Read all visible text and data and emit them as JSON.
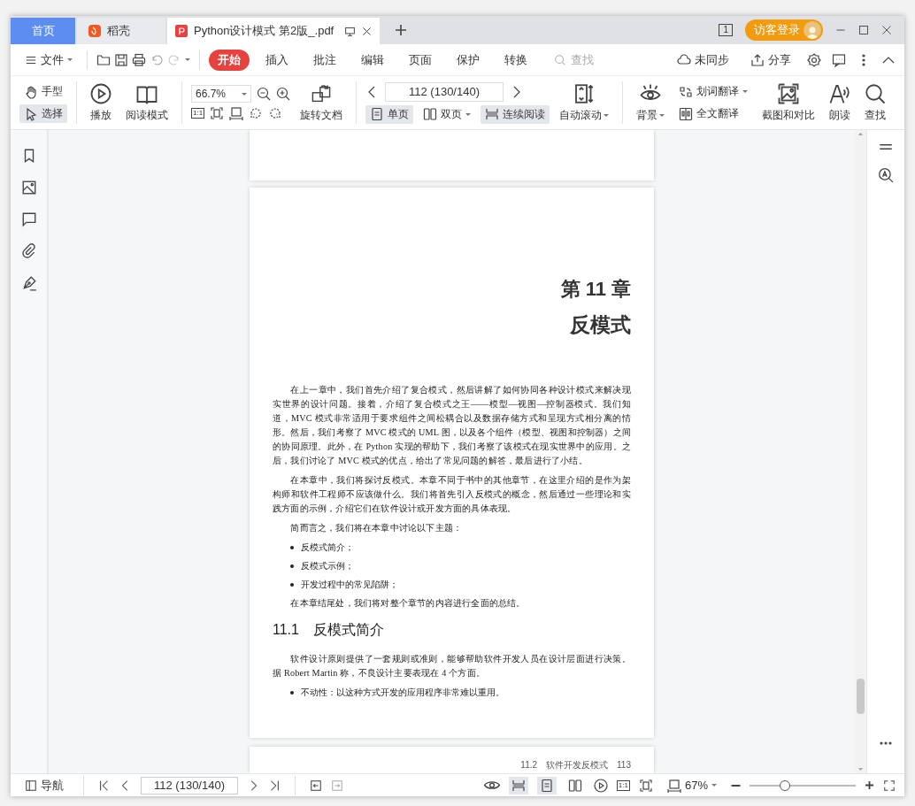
{
  "tabs": [
    {
      "label": "首页",
      "kind": "home",
      "selected": false
    },
    {
      "label": "稻壳",
      "kind": "app",
      "selected": false
    },
    {
      "label": "Python设计模式 第2版_.pdf",
      "kind": "doc",
      "selected": true
    }
  ],
  "title_bar": {
    "window_count": "1",
    "account": "访客登录"
  },
  "menu": {
    "file": "文件",
    "tabs": [
      {
        "label": "开始",
        "selected": true
      },
      {
        "label": "插入",
        "selected": false
      },
      {
        "label": "批注",
        "selected": false
      },
      {
        "label": "编辑",
        "selected": false
      },
      {
        "label": "页面",
        "selected": false
      },
      {
        "label": "保护",
        "selected": false
      },
      {
        "label": "转换",
        "selected": false
      }
    ],
    "search": {
      "placeholder": "查找"
    },
    "sync": "未同步",
    "share": "分享"
  },
  "toolbar": {
    "cursor_tools": [
      {
        "label": "手型",
        "kind": "hand",
        "selected": false
      },
      {
        "label": "选择",
        "kind": "pointer",
        "selected": true
      }
    ],
    "view_buttons": [
      {
        "label": "播放",
        "kind": "play"
      },
      {
        "label": "阅读模式",
        "kind": "book"
      }
    ],
    "zoom": {
      "value": "66.7%"
    },
    "actual_size": "1:1",
    "rotate": "旋转文档",
    "page_field": {
      "value": "112 (130/140)"
    },
    "page_modes": [
      {
        "label": "单页",
        "kind": "single",
        "selected": true,
        "dropdown": false
      },
      {
        "label": "双页",
        "kind": "double",
        "selected": false,
        "dropdown": true
      },
      {
        "label": "连续阅读",
        "kind": "continuous",
        "selected": true,
        "dropdown": false
      }
    ],
    "auto_scroll": "自动滚动",
    "background": "背景",
    "translate": [
      {
        "label": "划词翻译",
        "kind": "word",
        "dropdown": true
      },
      {
        "label": "全文翻译",
        "kind": "full",
        "dropdown": false
      }
    ],
    "tools": [
      {
        "label": "截图和对比",
        "kind": "screenshot"
      },
      {
        "label": "朗读",
        "kind": "read-aloud"
      },
      {
        "label": "查找",
        "kind": "search"
      }
    ]
  },
  "document": {
    "chapter_number": "第 11 章",
    "chapter_title": "反模式",
    "blocks": [
      {
        "kind": "paragraph",
        "text": "在上一章中，我们首先介绍了复合模式，然后讲解了如何协同各种设计模式来解决现实世界的设计问题。接着，介绍了复合模式之王——模型—视图—控制器模式。我们知道，MVC 模式非常适用于要求组件之间松耦合以及数据存储方式和呈现方式相分离的情形。然后，我们考察了 MVC 模式的 UML 图，以及各个组件（模型、视图和控制器）之间的协同原理。此外，在 Python 实现的帮助下，我们考察了该模式在现实世界中的应用。之后，我们讨论了 MVC 模式的优点，给出了常见问题的解答，最后进行了小结。"
      },
      {
        "kind": "paragraph",
        "text": "在本章中，我们将探讨反模式。本章不同于书中的其他章节，在这里介绍的是作为架构师和软件工程师不应该做什么。我们将首先引入反模式的概念，然后通过一些理论和实践方面的示例，介绍它们在软件设计或开发方面的具体表现。"
      },
      {
        "kind": "paragraph",
        "text": "简而言之，我们将在本章中讨论以下主题："
      },
      {
        "kind": "bullet",
        "text": "反模式简介；"
      },
      {
        "kind": "bullet",
        "text": "反模式示例；"
      },
      {
        "kind": "bullet",
        "text": "开发过程中的常见陷阱；"
      },
      {
        "kind": "paragraph",
        "text": "在本章结尾处，我们将对整个章节的内容进行全面的总结。"
      },
      {
        "kind": "heading",
        "text": "11.1　反模式简介"
      },
      {
        "kind": "paragraph",
        "text": "软件设计原则提供了一套规则或准则，能够帮助软件开发人员在设计层面进行决策。据 Robert Martin 称，不良设计主要表现在 4 个方面。"
      },
      {
        "kind": "bullet",
        "text": "不动性：以这种方式开发的应用程序非常难以重用。"
      }
    ],
    "next_page_header": "11.2　软件开发反模式　113"
  },
  "status_bar": {
    "nav": "导航",
    "page_field": {
      "value": "112 (130/140)"
    },
    "actual_size": "1:1",
    "view_modes": [
      {
        "kind": "continuous",
        "selected": true
      },
      {
        "kind": "single",
        "selected": true
      },
      {
        "kind": "double",
        "selected": false
      }
    ],
    "zoom": "67%",
    "zoom_slider": {
      "level": 0.33
    }
  }
}
